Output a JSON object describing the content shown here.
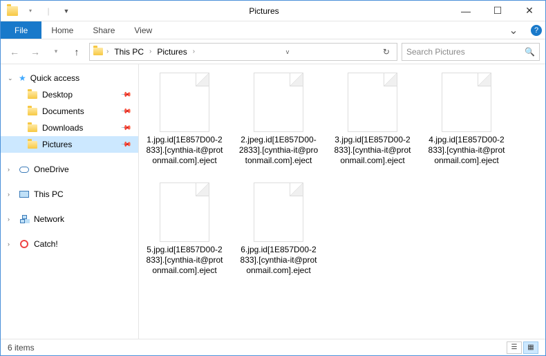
{
  "window": {
    "title": "Pictures"
  },
  "ribbon": {
    "file": "File",
    "tabs": [
      "Home",
      "Share",
      "View"
    ]
  },
  "nav_buttons": {
    "back": "←",
    "forward": "→",
    "up": "↑"
  },
  "breadcrumb": {
    "items": [
      "This PC",
      "Pictures"
    ]
  },
  "search": {
    "placeholder": "Search Pictures"
  },
  "sidebar": {
    "quick_access": {
      "label": "Quick access",
      "items": [
        {
          "label": "Desktop",
          "pinned": true
        },
        {
          "label": "Documents",
          "pinned": true
        },
        {
          "label": "Downloads",
          "pinned": true
        },
        {
          "label": "Pictures",
          "pinned": true,
          "selected": true
        }
      ]
    },
    "roots": [
      {
        "label": "OneDrive",
        "icon": "cloud"
      },
      {
        "label": "This PC",
        "icon": "monitor"
      },
      {
        "label": "Network",
        "icon": "net"
      },
      {
        "label": "Catch!",
        "icon": "disc"
      }
    ]
  },
  "files": [
    {
      "name": "1.jpg.id[1E857D00-2833].[cynthia-it@protonmail.com].eject"
    },
    {
      "name": "2.jpeg.id[1E857D00-2833].[cynthia-it@protonmail.com].eject"
    },
    {
      "name": "3.jpg.id[1E857D00-2833].[cynthia-it@protonmail.com].eject"
    },
    {
      "name": "4.jpg.id[1E857D00-2833].[cynthia-it@protonmail.com].eject"
    },
    {
      "name": "5.jpg.id[1E857D00-2833].[cynthia-it@protonmail.com].eject"
    },
    {
      "name": "6.jpg.id[1E857D00-2833].[cynthia-it@protonmail.com].eject"
    }
  ],
  "status": {
    "count_label": "6 items"
  }
}
